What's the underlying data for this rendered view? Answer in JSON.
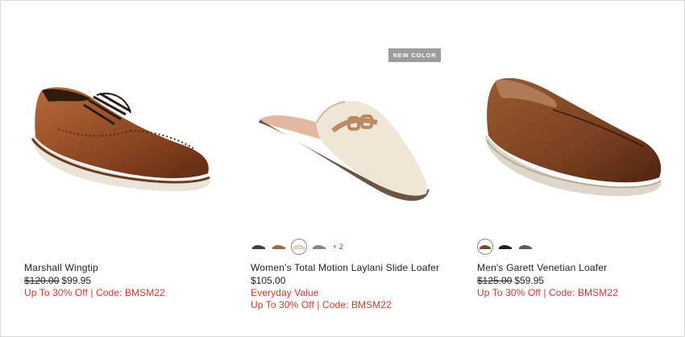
{
  "products": [
    {
      "name": "Marshall Wingtip",
      "original_price": "$120.00",
      "sale_price": "$99.95",
      "promo": "Up To 30% Off | Code: BMSM22"
    },
    {
      "badge": "NEW COLOR",
      "swatches": [
        {
          "color": "#3f3f3f",
          "icon": "black-loafer-swatch"
        },
        {
          "color": "#9a6a3c",
          "icon": "brown-loafer-swatch"
        },
        {
          "color": "#e6dccb",
          "icon": "cream-loafer-swatch",
          "selected": true
        },
        {
          "color": "#8e867c",
          "icon": "taupe-loafer-swatch"
        }
      ],
      "more_swatches": "+ 2",
      "name": "Women's Total Motion Laylani Slide Loafer",
      "price": "$105.00",
      "value_tag": "Everyday Value",
      "promo": "Up To 30% Off | Code: BMSM22"
    },
    {
      "swatches": [
        {
          "color": "#7a4a2a",
          "icon": "brown-loafer-swatch",
          "selected": true
        },
        {
          "color": "#1f1f1f",
          "icon": "black-loafer-swatch"
        },
        {
          "color": "#5a5a5a",
          "icon": "grey-loafer-swatch"
        }
      ],
      "name": "Men's Garett Venetian Loafer",
      "original_price": "$125.00",
      "sale_price": "$59.95",
      "promo": "Up To 30% Off | Code: BMSM22"
    }
  ],
  "colors": {
    "promo": "#d63a2a",
    "badge_bg": "#9c9c9c"
  }
}
